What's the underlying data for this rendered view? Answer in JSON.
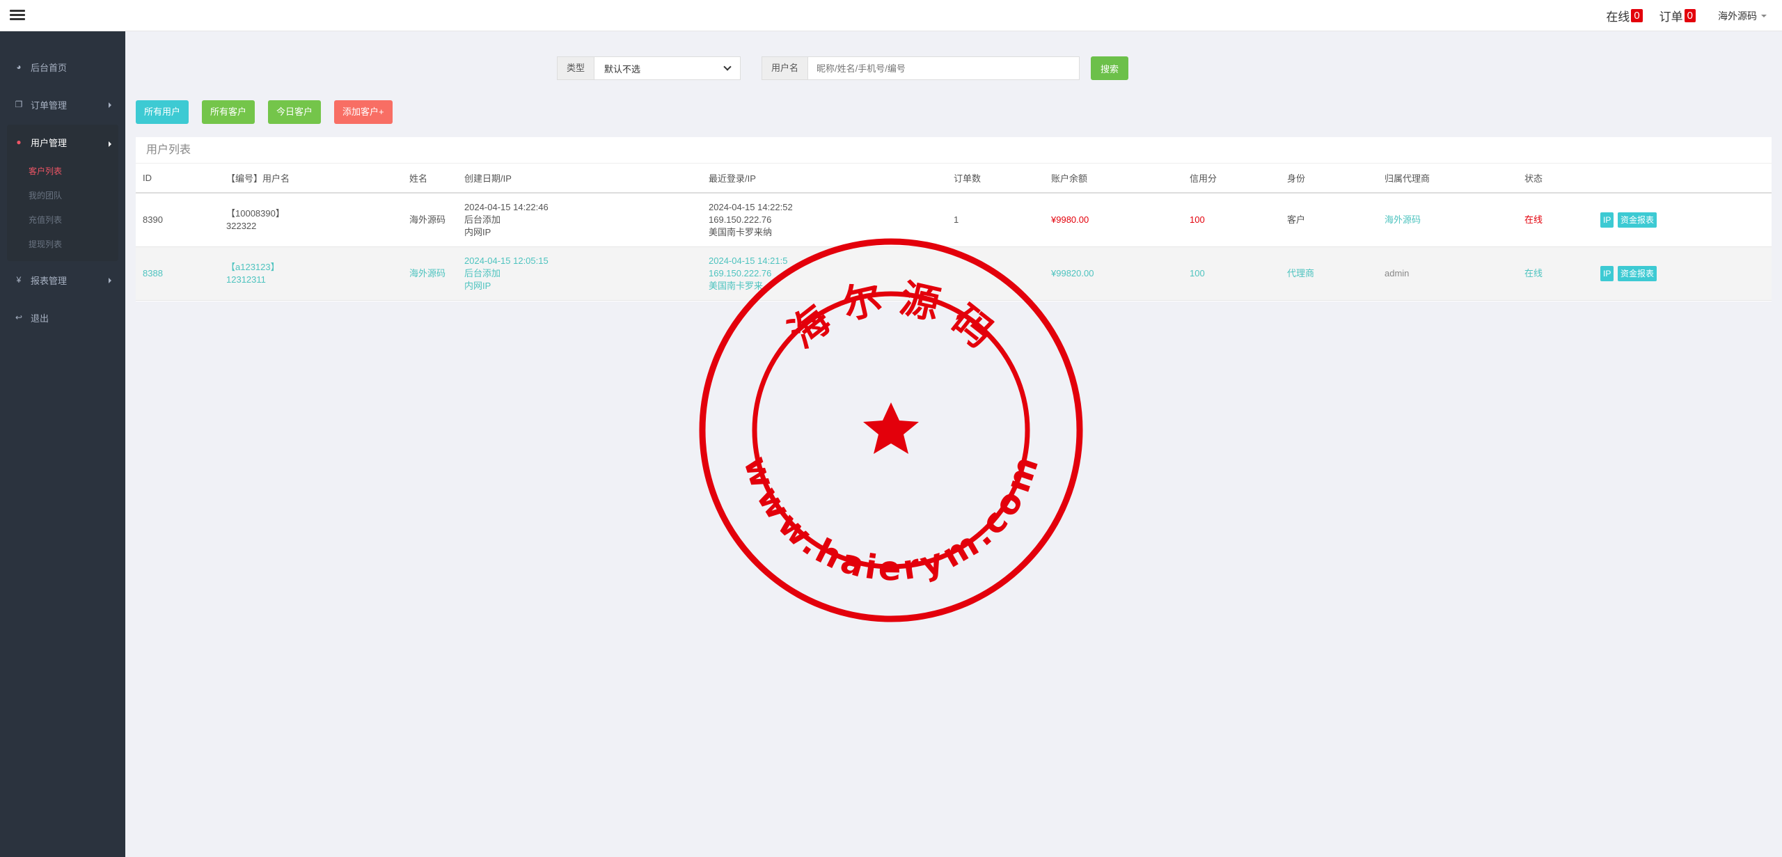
{
  "header": {
    "online_label": "在线",
    "online_count": "0",
    "orders_label": "订单",
    "orders_count": "0",
    "user_name": "海外源码"
  },
  "sidebar": {
    "items": [
      {
        "label": "后台首页",
        "icon": "dashboard-icon"
      },
      {
        "label": "订单管理",
        "icon": "copy-icon"
      },
      {
        "label": "用户管理",
        "icon": "user-icon"
      },
      {
        "label": "报表管理",
        "icon": "yen-icon"
      },
      {
        "label": "退出",
        "icon": "sign-out-icon"
      }
    ],
    "sub_items": [
      "客户列表",
      "我的团队",
      "充值列表",
      "提现列表"
    ]
  },
  "search": {
    "type_label": "类型",
    "type_value": "默认不选",
    "user_label": "用户名",
    "user_placeholder": "昵称/姓名/手机号/编号",
    "search_button": "搜索"
  },
  "buttons": {
    "all_users": "所有用户",
    "all_customers": "所有客户",
    "today_customers": "今日客户",
    "add_customer": "添加客户+"
  },
  "panel": {
    "title": "用户列表",
    "columns": [
      "ID",
      "【编号】用户名",
      "姓名",
      "创建日期/IP",
      "最近登录/IP",
      "订单数",
      "账户余额",
      "信用分",
      "身份",
      "归属代理商",
      "状态"
    ],
    "rows": [
      {
        "id": "8390",
        "code": "【10008390】",
        "username": "322322",
        "name": "海外源码",
        "created_date": "2024-04-15 14:22:46",
        "created_source": "后台添加",
        "created_ip": "内网IP",
        "login_date": "2024-04-15 14:22:52",
        "login_ip": "169.150.222.76",
        "login_location": "美国南卡罗来纳",
        "orders": "1",
        "balance": "¥9980.00",
        "credit": "100",
        "role": "客户",
        "agent": "海外源码",
        "status": "在线",
        "actions": [
          "IP",
          "资金报表"
        ]
      },
      {
        "id": "8388",
        "code": "【a123123】",
        "username": "12312311",
        "name": "海外源码",
        "created_date": "2024-04-15 12:05:15",
        "created_source": "后台添加",
        "created_ip": "内网IP",
        "login_date": "2024-04-15 14:21:5",
        "login_ip": "169.150.222.76",
        "login_location": "美国南卡罗来",
        "orders": "",
        "balance": "¥99820.00",
        "credit": "100",
        "role": "代理商",
        "agent": "admin",
        "status": "在线",
        "actions": [
          "IP",
          "资金报表"
        ]
      }
    ]
  },
  "stamp": {
    "top_text": "海 尔 源 码",
    "bottom_text": "www.haierym.com",
    "color": "#e3000b"
  }
}
